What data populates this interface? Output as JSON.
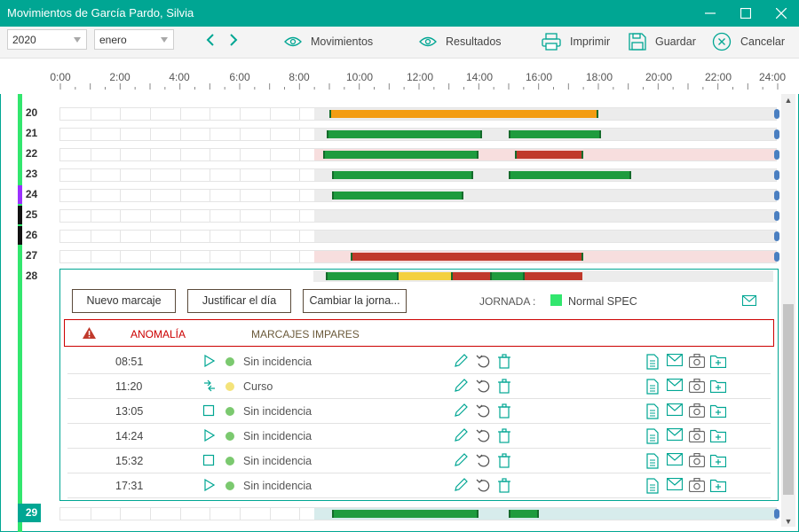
{
  "window": {
    "title": "Movimientos de García Pardo, Silvia"
  },
  "toolbar": {
    "year": "2020",
    "month": "enero",
    "movimientos_label": "Movimientos",
    "resultados_label": "Resultados",
    "imprimir_label": "Imprimir",
    "guardar_label": "Guardar",
    "cancelar_label": "Cancelar"
  },
  "ruler": {
    "ticks": [
      "0:00",
      "2:00",
      "4:00",
      "6:00",
      "8:00",
      "10:00",
      "12:00",
      "14:00",
      "16:00",
      "18:00",
      "20:00",
      "22:00",
      "24:00"
    ]
  },
  "days": [
    {
      "num": "20",
      "color": "#32e66e",
      "bg": "#ececec",
      "bars": [
        {
          "start": 9.0,
          "end": 18.0,
          "color": "#f39c12"
        }
      ]
    },
    {
      "num": "21",
      "color": "#32e66e",
      "bg": "#ececec",
      "bars": [
        {
          "start": 8.9,
          "end": 14.1,
          "color": "#1e9b3e"
        },
        {
          "start": 15.0,
          "end": 18.1,
          "color": "#1e9b3e"
        }
      ]
    },
    {
      "num": "22",
      "color": "#32e66e",
      "bg": "#f7dede",
      "bars": [
        {
          "start": 8.8,
          "end": 14.0,
          "color": "#1e9b3e"
        },
        {
          "start": 15.2,
          "end": 17.5,
          "color": "#c0392b"
        }
      ]
    },
    {
      "num": "23",
      "color": "#32e66e",
      "bg": "#ececec",
      "bars": [
        {
          "start": 9.1,
          "end": 13.8,
          "color": "#1e9b3e"
        },
        {
          "start": 15.0,
          "end": 19.1,
          "color": "#1e9b3e"
        }
      ]
    },
    {
      "num": "24",
      "color": "#9b30ff",
      "bg": "#ececec",
      "bars": [
        {
          "start": 9.1,
          "end": 13.5,
          "color": "#1e9b3e"
        }
      ]
    },
    {
      "num": "25",
      "color": "#111111",
      "bg": "#ececec",
      "bars": []
    },
    {
      "num": "26",
      "color": "#111111",
      "bg": "#ececec",
      "bars": []
    },
    {
      "num": "27",
      "color": "#32e66e",
      "bg": "#f7dede",
      "bars": [
        {
          "start": 9.7,
          "end": 17.5,
          "color": "#c0392b"
        }
      ]
    },
    {
      "num": "28",
      "color": "#32e66e",
      "bg": "#ececec",
      "bars": [
        {
          "start": 8.9,
          "end": 11.3,
          "color": "#1e9b3e"
        },
        {
          "start": 11.3,
          "end": 13.1,
          "color": "#f4d03f"
        },
        {
          "start": 13.1,
          "end": 14.4,
          "color": "#c0392b"
        },
        {
          "start": 14.4,
          "end": 15.5,
          "color": "#1e9b3e"
        },
        {
          "start": 15.5,
          "end": 17.5,
          "color": "#c0392b"
        }
      ]
    },
    {
      "num": "29",
      "color": "#00a693",
      "bg": "#d7ecec",
      "bars": [
        {
          "start": 9.1,
          "end": 14.0,
          "color": "#1e9b3e"
        },
        {
          "start": 15.0,
          "end": 16.0,
          "color": "#1e9b3e"
        }
      ]
    }
  ],
  "panel": {
    "nuevo_marcaje": "Nuevo marcaje",
    "justificar": "Justificar el día",
    "cambiar": "Cambiar la jorna...",
    "jornada_label": "JORNADA :",
    "jornada_value": "Normal SPEC",
    "jornada_color": "#32e66e",
    "anomalia_label": "ANOMALÍA",
    "anomalia_text": "MARCAJES IMPARES"
  },
  "marcajes": [
    {
      "time": "08:51",
      "icon": "play-icon",
      "dot": "#7bc96f",
      "incidencia": "Sin incidencia"
    },
    {
      "time": "11:20",
      "icon": "transfer-icon",
      "dot": "#f4e37a",
      "incidencia": "Curso"
    },
    {
      "time": "13:05",
      "icon": "stop-icon",
      "dot": "#7bc96f",
      "incidencia": "Sin incidencia"
    },
    {
      "time": "14:24",
      "icon": "play-icon",
      "dot": "#7bc96f",
      "incidencia": "Sin incidencia"
    },
    {
      "time": "15:32",
      "icon": "stop-icon",
      "dot": "#7bc96f",
      "incidencia": "Sin incidencia"
    },
    {
      "time": "17:31",
      "icon": "play-icon",
      "dot": "#7bc96f",
      "incidencia": "Sin incidencia"
    }
  ]
}
